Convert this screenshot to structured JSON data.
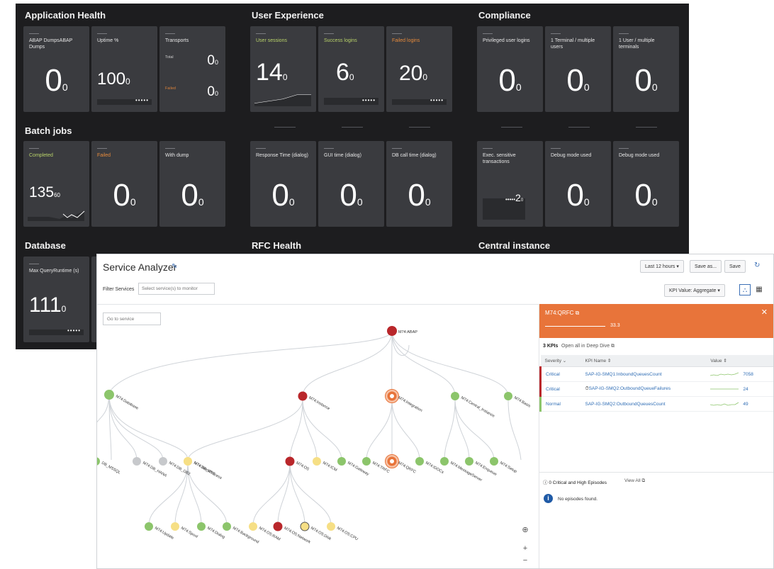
{
  "dashboard": {
    "sections": {
      "app_health": "Application Health",
      "user_exp": "User Experience",
      "compliance": "Compliance",
      "batch_jobs": "Batch jobs",
      "database": "Database",
      "rfc_health": "RFC Health",
      "central_instance": "Central instance"
    },
    "cards": {
      "abap_dumps": {
        "label": "ABAP DumpsABAP Dumps",
        "value": "0",
        "unit": "0"
      },
      "uptime": {
        "label": "Uptime %",
        "value": "100",
        "unit": "0"
      },
      "transports": {
        "label": "Transports",
        "total_label": "Total",
        "total_value": "0",
        "total_unit": "0",
        "failed_label": "Failed",
        "failed_value": "0",
        "failed_unit": "0"
      },
      "user_sessions": {
        "label": "User sessions",
        "value": "14",
        "unit": "0"
      },
      "success_logins": {
        "label": "Success logins",
        "value": "6",
        "unit": "0"
      },
      "failed_logins": {
        "label": "Failed logins",
        "value": "20",
        "unit": "0"
      },
      "priv_logins": {
        "label": "Privileged user logins",
        "value": "0",
        "unit": "0"
      },
      "one_terminal": {
        "label": "1 Terminal / multiple users",
        "value": "0",
        "unit": "0"
      },
      "one_user": {
        "label": "1 User / multiple terminals",
        "value": "0",
        "unit": "0"
      },
      "completed": {
        "label": "Completed",
        "value": "135",
        "unit": "60"
      },
      "failed": {
        "label": "Failed",
        "value": "0",
        "unit": "0"
      },
      "with_dump": {
        "label": "With dump",
        "value": "0",
        "unit": "0"
      },
      "response_time": {
        "label": "Response Time (dialog)",
        "value": "0",
        "unit": "0"
      },
      "gui_time": {
        "label": "GUI time (dialog)",
        "value": "0",
        "unit": "0"
      },
      "db_call_time": {
        "label": "DB call time (dialog)",
        "value": "0",
        "unit": "0"
      },
      "exec_sensitive": {
        "label": "Exec. sensitive transactions",
        "value": "2",
        "unit": "0"
      },
      "debug_mode_1": {
        "label": "Debug mode used",
        "value": "0",
        "unit": "0"
      },
      "debug_mode_2": {
        "label": "Debug mode used",
        "value": "0",
        "unit": "0"
      },
      "max_query": {
        "label": "Max QueryRuntime (s)",
        "value": "111",
        "unit": "0"
      }
    },
    "colors": {
      "green_label": "#b9d36a",
      "orange_label": "#e58a3c",
      "failed_label": "#d9813b"
    }
  },
  "service_analyzer": {
    "title": "Service Analyzer",
    "buttons": {
      "last": "Last 12 hours ▾",
      "save_as": "Save as...",
      "save": "Save",
      "kpi_value": "KPI Value: Aggregate ▾"
    },
    "filter": {
      "label": "Filter Services",
      "placeholder": "Select service(s) to monitor"
    },
    "goto_placeholder": "Go to service",
    "nodes": {
      "abap": "M74:ABAP",
      "database": "M74:Database",
      "instance": "M74:Instance",
      "integration": "M74:Integration",
      "central": "M74:Central_Instance",
      "basis": "M74:Basis",
      "db_mssql": "DB_MSSQL",
      "db_hana": "M74:DB_HANA",
      "db_db2": "M74:DB_DB2",
      "db_ase": "M74:DB_ASE",
      "workprocess": "M74:WorkProcess",
      "os": "M74:OS",
      "icm": "M74:ICM",
      "gateway": "M74:Gateway",
      "trfc": "M74:TRFC",
      "qrfc": "M74:QRFC",
      "idocs": "M74:IDOCs",
      "msgserver": "M74:MessageServer",
      "enqueue": "M74:Enqueue",
      "setup": "M74:Setup",
      "update": "M74:Update",
      "spool": "M74:Spool",
      "dialog": "M74:Dialog",
      "background": "M74:Background",
      "os_ram": "M74:OS:RAM",
      "os_network": "M74:OS:Network",
      "os_disk": "M74:OS:Disk",
      "os_cpu": "M74:OS:CPU"
    },
    "panel": {
      "name": "M74:QRFC",
      "score": "33.3",
      "kpi_count": "3 KPIs",
      "open_all": "Open all in Deep Dive",
      "columns": {
        "severity": "Severity",
        "kpi_name": "KPI Name",
        "value": "Value"
      },
      "rows": [
        {
          "severity": "Critical",
          "kpi_name": "SAP-IG-SMQ1:InboundQueuesCount",
          "value": "7058"
        },
        {
          "severity": "Critical",
          "kpi_name": "SAP-IG-SMQ2:OutboundQueueFailures",
          "value": "24"
        },
        {
          "severity": "Normal",
          "kpi_name": "SAP-IG-SMQ2:OutboundQueuesCount",
          "value": "49"
        }
      ],
      "episodes": "0 Critical and High Episodes",
      "view_all": "View All",
      "no_episodes": "No episodes found."
    },
    "status_colors": {
      "critical": "#b9272b",
      "high": "#e8743a",
      "normal": "#8cc56b",
      "low": "#f6df85",
      "unknown": "#c7c9cc"
    }
  }
}
